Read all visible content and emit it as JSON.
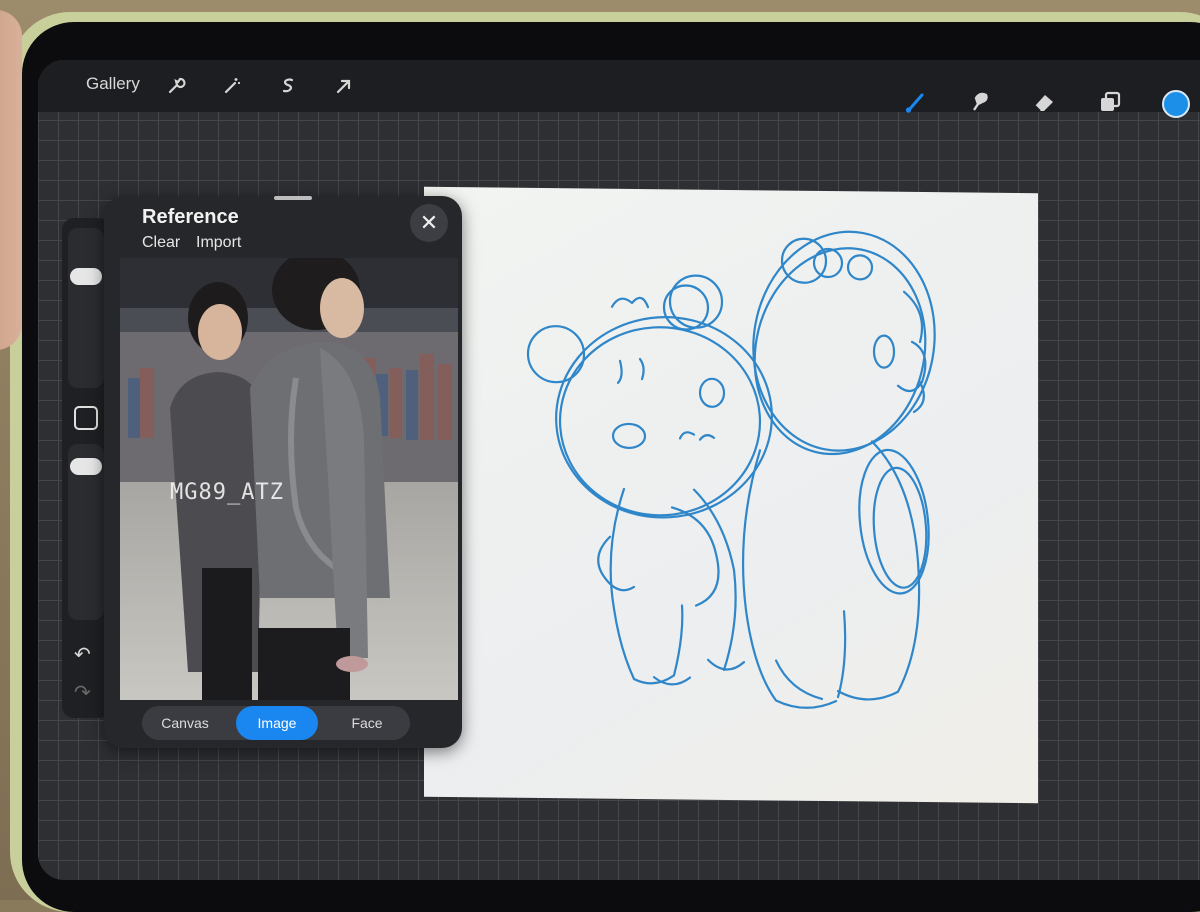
{
  "topbar": {
    "gallery_label": "Gallery",
    "left_tools": [
      "wrench-icon",
      "magic-wand-icon",
      "selection-icon",
      "transform-arrow-icon"
    ],
    "right_tools": [
      "brush-icon",
      "smudge-icon",
      "eraser-icon",
      "layers-icon"
    ],
    "active_tool": "brush-icon",
    "brush_active_color": "#1a86f0",
    "current_color": "#1c8fe8"
  },
  "reference_panel": {
    "title": "Reference",
    "clear_label": "Clear",
    "import_label": "Import",
    "close_symbol": "✕",
    "watermark": "MG89_ATZ",
    "modes": [
      "Canvas",
      "Image",
      "Face"
    ],
    "active_mode": "Image",
    "accent": "#1a86f0"
  },
  "sidebar": {
    "undo_symbol": "↶",
    "redo_symbol": "↷"
  },
  "canvas": {
    "background": "#f0f2f0",
    "stroke_color": "#2f86c9"
  }
}
